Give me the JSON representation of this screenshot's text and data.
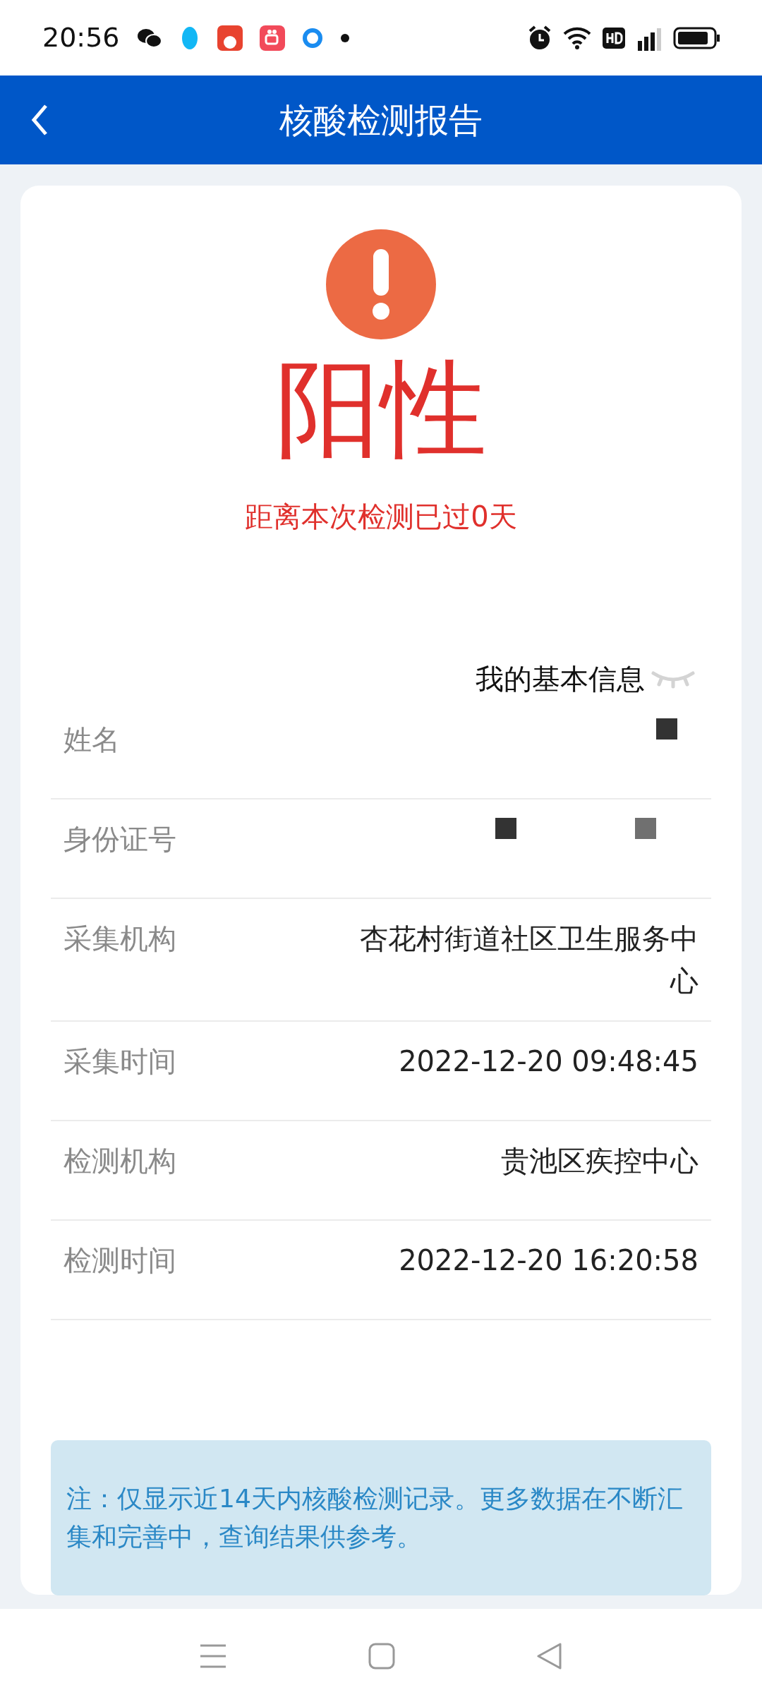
{
  "status_bar": {
    "time": "20:56"
  },
  "header": {
    "title": "核酸检测报告"
  },
  "result": {
    "label": "阳性",
    "days_text": "距离本次检测已过0天"
  },
  "info": {
    "title": "我的基本信息",
    "rows": [
      {
        "label": "姓名",
        "value": "",
        "redacted": true
      },
      {
        "label": "身份证号",
        "value": "",
        "redacted": true
      },
      {
        "label": "采集机构",
        "value": "杏花村街道社区卫生服务中心",
        "redacted": false
      },
      {
        "label": "采集时间",
        "value": "2022-12-20 09:48:45",
        "redacted": false
      },
      {
        "label": "检测机构",
        "value": "贵池区疾控中心",
        "redacted": false
      },
      {
        "label": "检测时间",
        "value": "2022-12-20 16:20:58",
        "redacted": false
      }
    ]
  },
  "note": "注：仅显示近14天内核酸检测记录。更多数据在不断汇集和完善中，查询结果供参考。"
}
